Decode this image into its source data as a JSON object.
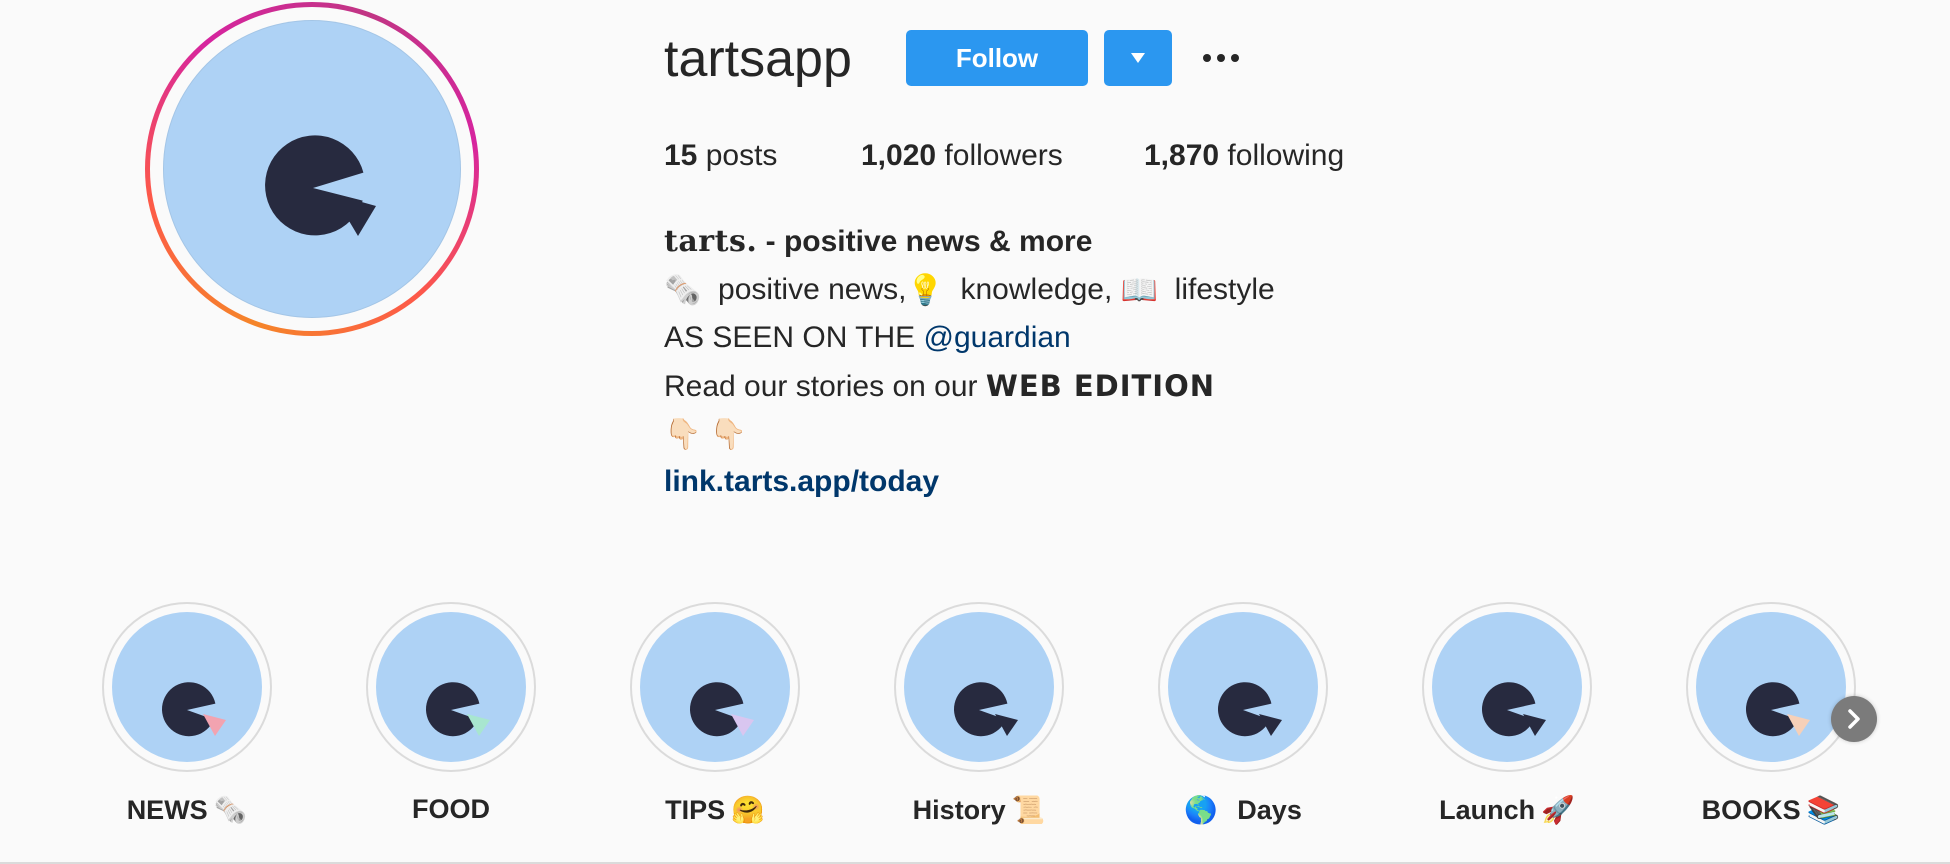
{
  "profile": {
    "username": "tartsapp",
    "follow_label": "Follow",
    "stats": {
      "posts_count": "15",
      "posts_label": "posts",
      "followers_count": "1,020",
      "followers_label": "followers",
      "following_count": "1,870",
      "following_label": "following"
    }
  },
  "bio": {
    "brand": "tarts.",
    "title_rest": "- positive news & more",
    "line2": {
      "emoji1": "🗞️",
      "text1": "positive news,",
      "emoji2": "💡",
      "text2": "knowledge,",
      "emoji3": "📖",
      "text3": "lifestyle"
    },
    "line3": {
      "text": "AS SEEN ON THE ",
      "mention": "@guardian"
    },
    "line4": {
      "text": "Read our stories on our ",
      "bold": "WEB EDITION"
    },
    "line5": {
      "emojis": "👇🏻 👇🏻"
    },
    "link": "link.tarts.app/today"
  },
  "highlights": [
    {
      "label": "NEWS",
      "emoji": "🗞️",
      "accent": "#f2a3b0"
    },
    {
      "label": "FOOD",
      "emoji": "",
      "accent": "#a8e6cf"
    },
    {
      "label": "TIPS",
      "emoji": "🤗",
      "accent": "#d9c6f0"
    },
    {
      "label": "History",
      "emoji": "📜",
      "accent": "#aed2f5"
    },
    {
      "label": "Days",
      "emoji": "🌎",
      "emoji_first": true,
      "accent": "#aed2f5"
    },
    {
      "label": "Launch",
      "emoji": "🚀",
      "accent": "#aed2f5"
    },
    {
      "label": "BOOKS",
      "emoji": "📚",
      "accent": "#f6d0b8"
    }
  ],
  "colors": {
    "avatar_bg": "#aed2f5",
    "logo_dark": "#272a3f",
    "button_blue": "#2b97f0",
    "link_blue": "#00376b"
  },
  "icons": {
    "dropdown": "chevron-down-icon",
    "more": "more-horizontal-icon",
    "next": "chevron-right-icon"
  }
}
